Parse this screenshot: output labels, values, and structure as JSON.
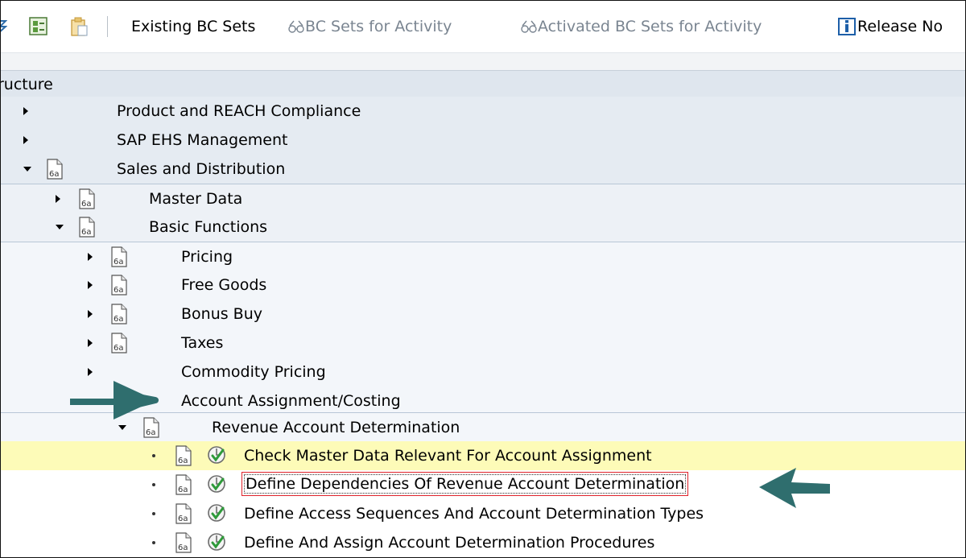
{
  "toolbar": {
    "existing_bc_sets": "Existing BC Sets",
    "bc_sets_for_activity": "BC Sets for Activity",
    "activated_bc_sets": "Activated BC Sets for Activity",
    "release_notes": "Release No"
  },
  "tree": {
    "header": "ructure",
    "rows": [
      {
        "label": "Product and REACH Compliance"
      },
      {
        "label": "SAP EHS Management"
      },
      {
        "label": "Sales and Distribution"
      },
      {
        "label": "Master Data"
      },
      {
        "label": "Basic Functions"
      },
      {
        "label": "Pricing"
      },
      {
        "label": "Free Goods"
      },
      {
        "label": "Bonus Buy"
      },
      {
        "label": "Taxes"
      },
      {
        "label": "Commodity Pricing"
      },
      {
        "label": "Account Assignment/Costing"
      },
      {
        "label": "Revenue Account Determination"
      },
      {
        "label": "Check Master Data Relevant For Account Assignment"
      },
      {
        "label": "Define Dependencies Of Revenue Account Determination"
      },
      {
        "label": "Define Access Sequences And Account Determination Types"
      },
      {
        "label": "Define And Assign Account Determination Procedures"
      }
    ]
  },
  "colors": {
    "accent_arrow": "#2f6e6e",
    "highlight_row": "#fdfbb8",
    "selection_border": "#e0222a"
  }
}
